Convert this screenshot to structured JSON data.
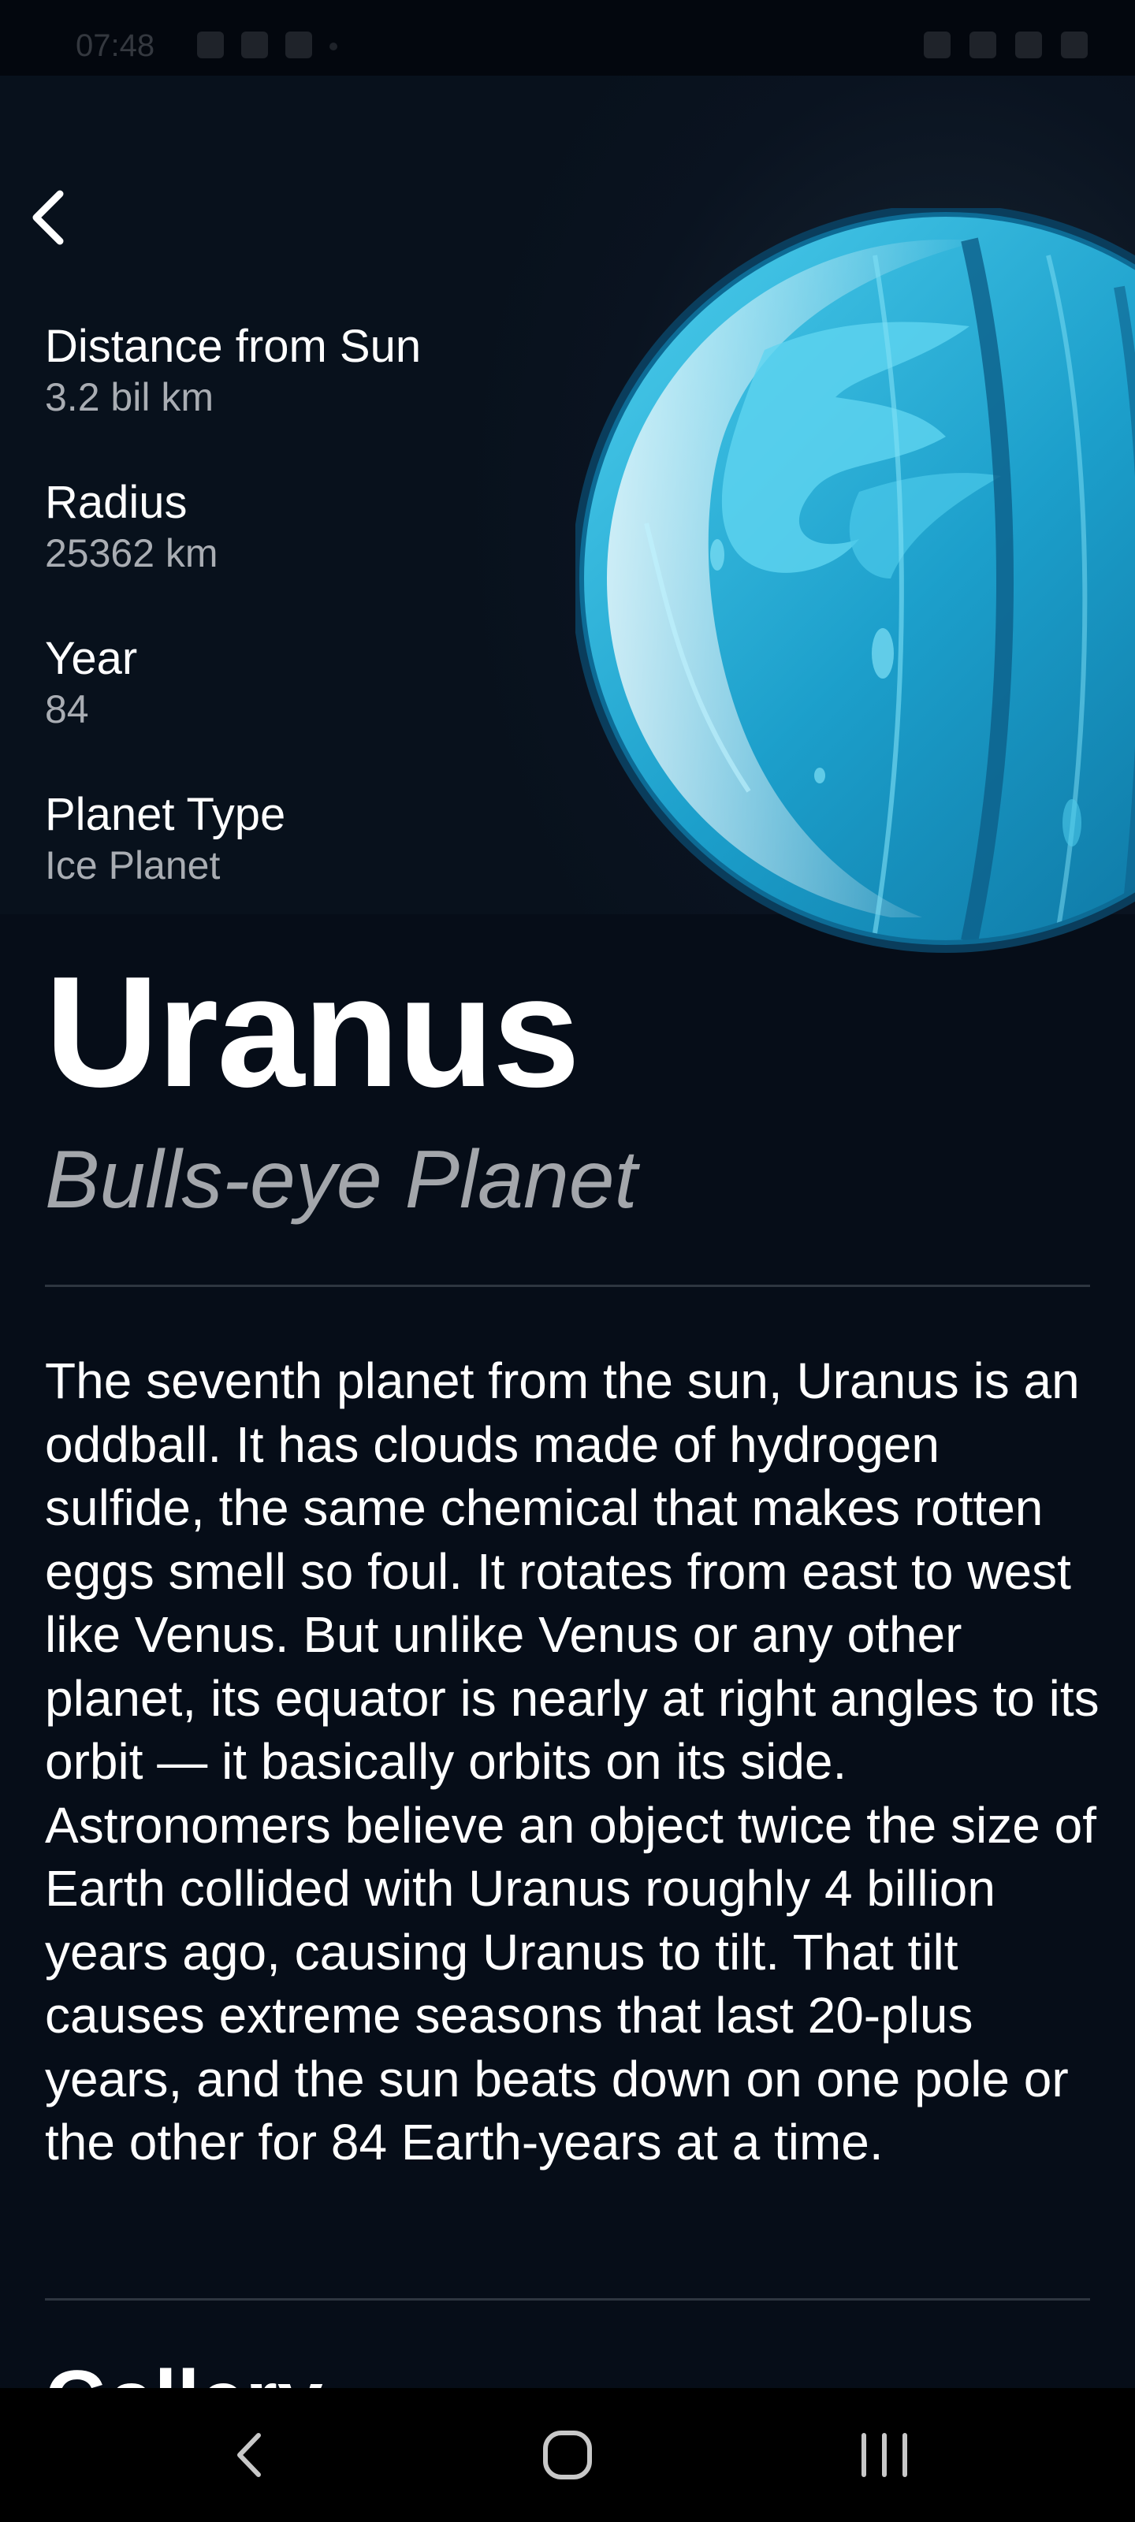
{
  "status_bar": {
    "time": "07:48"
  },
  "planet": {
    "name": "Uranus",
    "nickname": "Bulls-eye Planet",
    "stats": [
      {
        "label": "Distance from Sun",
        "value": "3.2 bil km"
      },
      {
        "label": "Radius",
        "value": "25362 km"
      },
      {
        "label": "Year",
        "value": "84"
      },
      {
        "label": "Planet Type",
        "value": "Ice Planet"
      }
    ],
    "description": "The seventh planet from the sun, Uranus is an oddball. It has clouds made of hydrogen sulfide, the same chemical that makes rotten eggs smell so foul. It rotates from east to west like Venus. But unlike Venus or any other planet, its equator is nearly at right angles to its orbit — it basically orbits on its side. Astronomers believe an object twice the size of Earth collided with Uranus roughly 4 billion years ago, causing Uranus to tilt. That tilt causes extreme seasons that last 20-plus years, and the sun beats down on one pole or the other for 84 Earth-years at a time.",
    "next_section_heading": "Gallery"
  },
  "icons": {
    "back": "chevron-left-icon",
    "nav_back": "nav-back-icon",
    "nav_home": "nav-home-icon",
    "nav_recent": "nav-recent-apps-icon"
  },
  "colors": {
    "background": "#060d18",
    "planet_light": "#3ec3e6",
    "planet_dark": "#0e86b3",
    "text_secondary": "#a9adb3"
  }
}
